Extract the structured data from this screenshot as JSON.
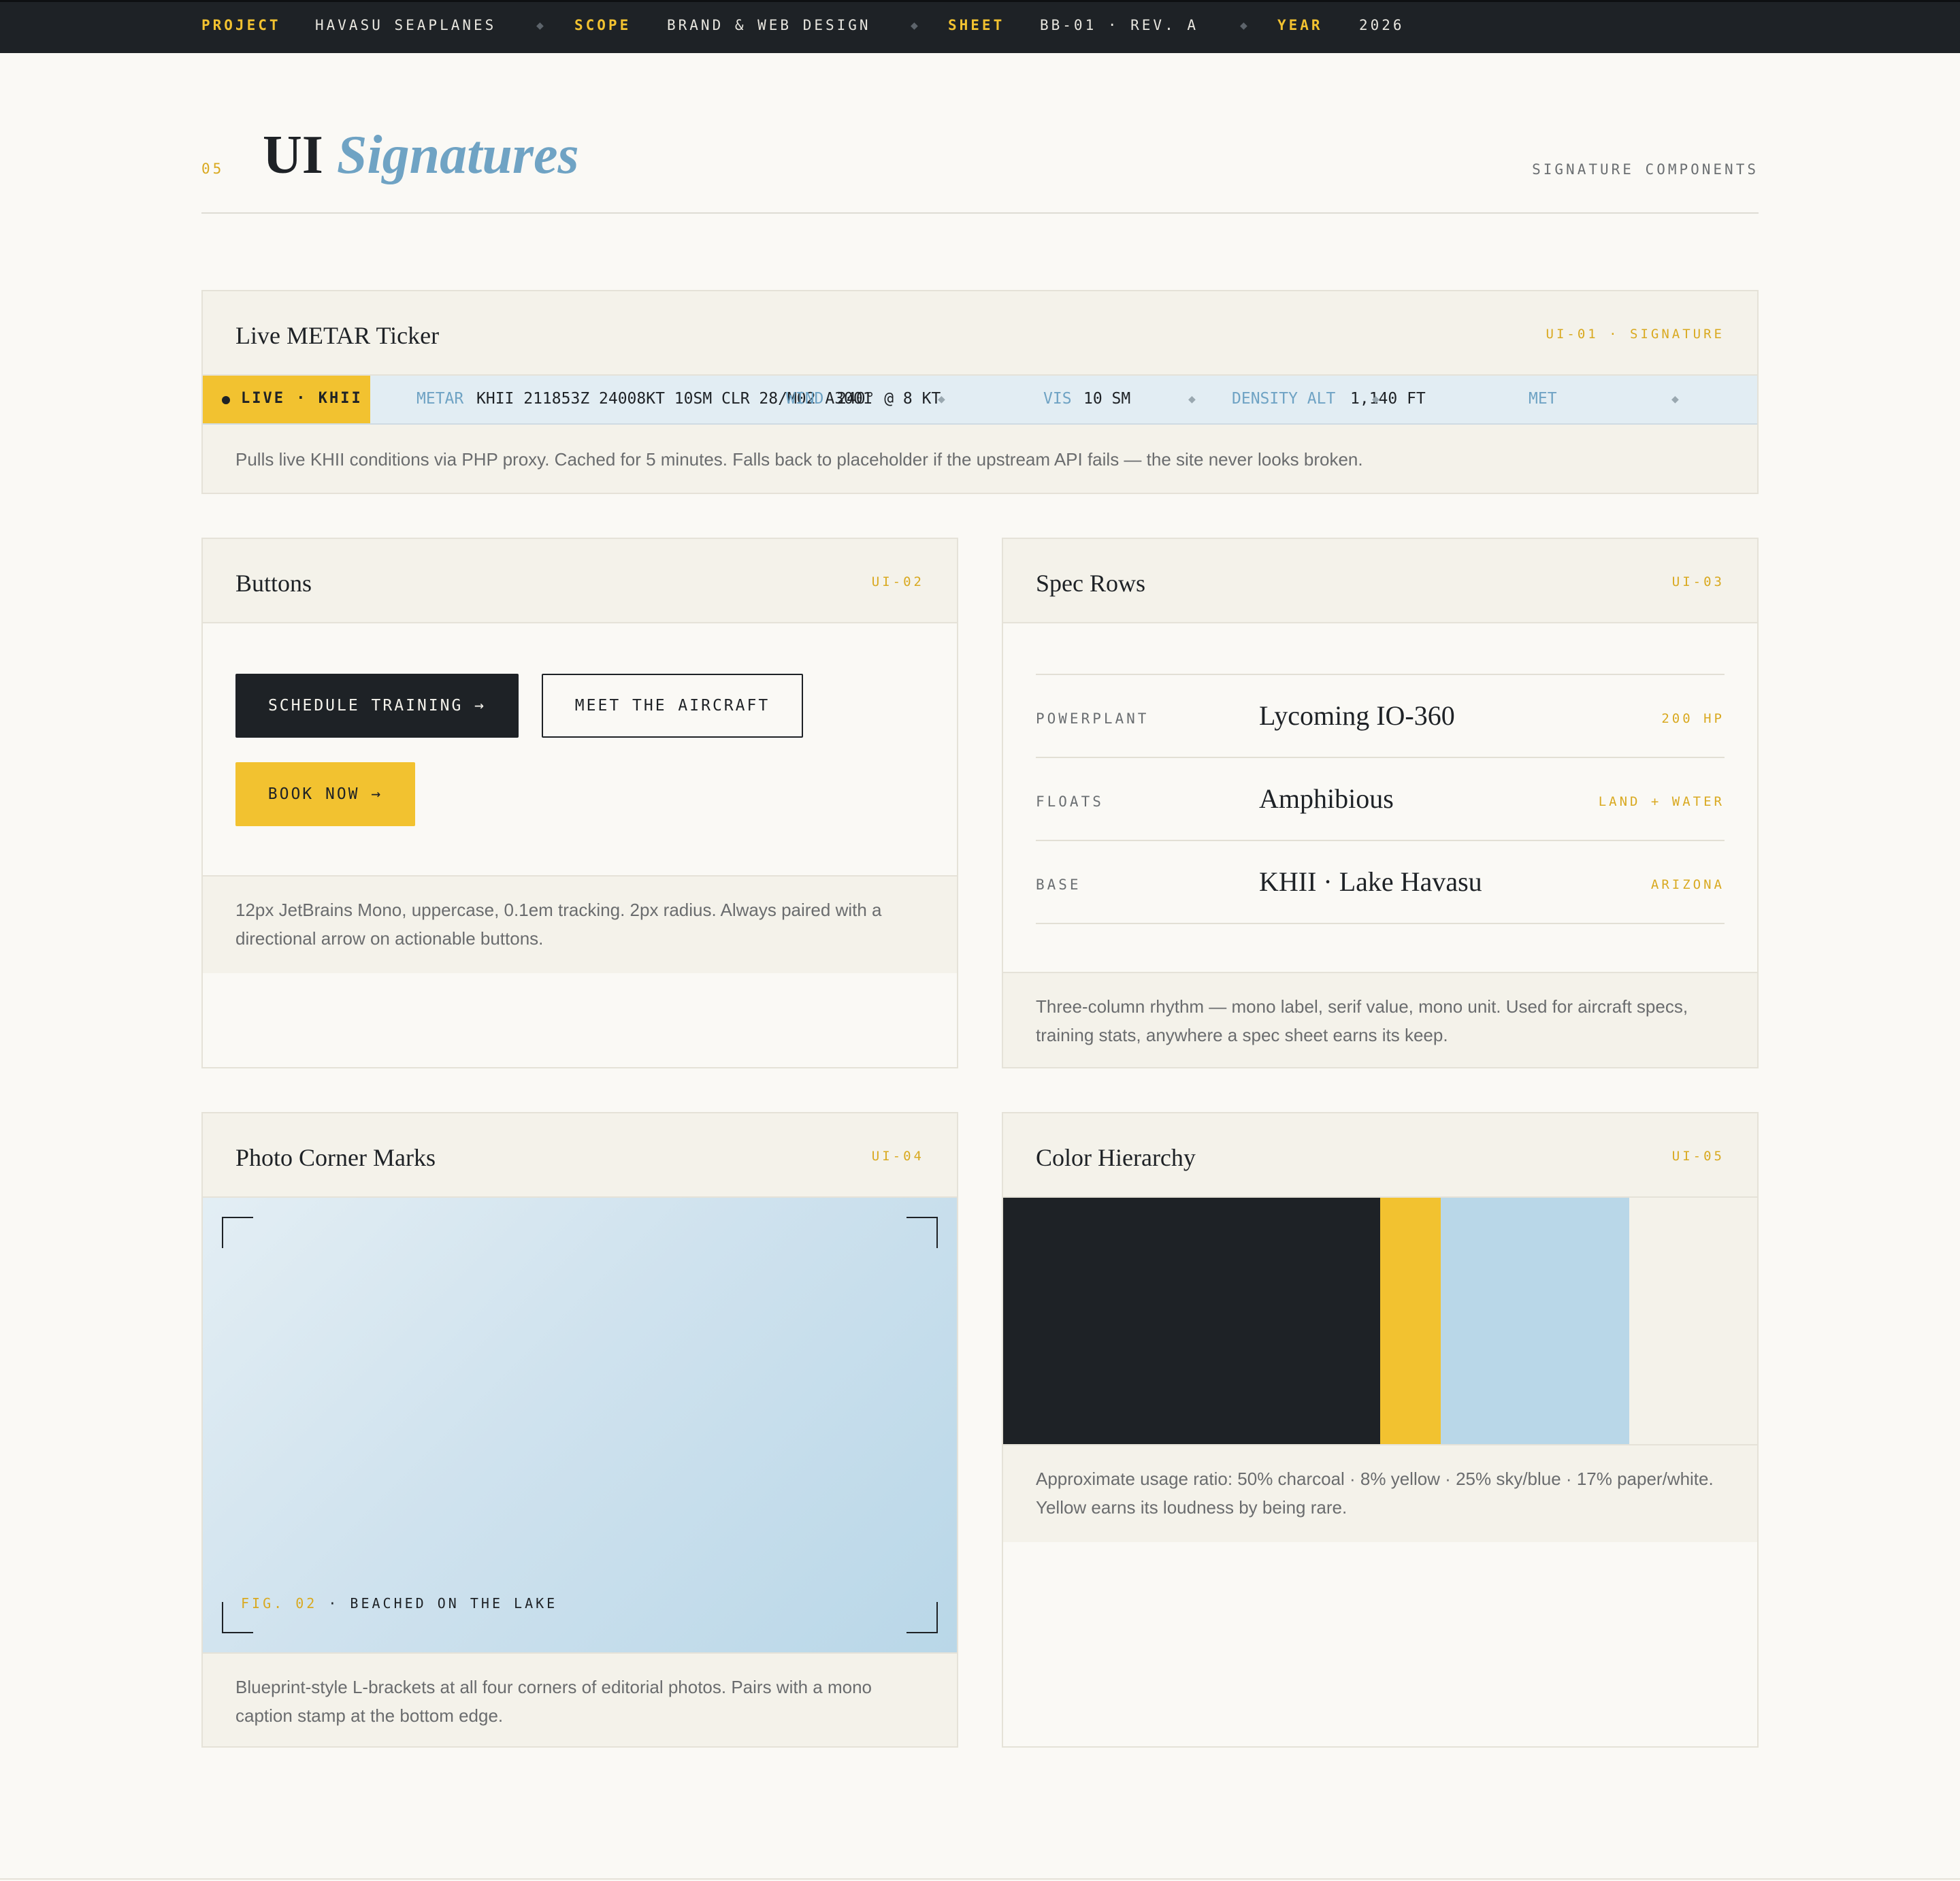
{
  "topbar": {
    "project_key": "PROJECT",
    "project_val": "HAVASU SEAPLANES",
    "scope_key": "SCOPE",
    "scope_val": "BRAND & WEB DESIGN",
    "sheet_key": "SHEET",
    "sheet_val": "BB-01 · REV. A",
    "year_key": "YEAR",
    "year_val": "2026",
    "separator": "◆"
  },
  "header": {
    "section_number": "05",
    "title_plain": "UI",
    "title_italic": "Signatures",
    "right_label": "SIGNATURE COMPONENTS"
  },
  "ticker_card": {
    "title": "Live METAR Ticker",
    "tag": "UI-01 · SIGNATURE",
    "live_label": "LIVE · KHII",
    "items": [
      {
        "label": "METAR",
        "value": "KHII 211853Z 24008KT 10SM CLR 28/M02 A3001"
      },
      {
        "label": "WIND",
        "value": "240° @ 8 KT"
      },
      {
        "label": "VIS",
        "value": "10 SM"
      },
      {
        "label": "DENSITY ALT",
        "value": "1,140 FT"
      },
      {
        "label": "MET",
        "value": ""
      }
    ],
    "note": "Pulls live KHII conditions via PHP proxy. Cached for 5 minutes. Falls back to placeholder if the upstream API fails — the site never looks broken."
  },
  "buttons_card": {
    "title": "Buttons",
    "tag": "UI-02",
    "primary": "SCHEDULE TRAINING →",
    "secondary": "MEET THE AIRCRAFT",
    "accent": "BOOK NOW →",
    "note": "12px JetBrains Mono, uppercase, 0.1em tracking. 2px radius. Always paired with a directional arrow on actionable buttons."
  },
  "spec_card": {
    "title": "Spec Rows",
    "tag": "UI-03",
    "rows": [
      {
        "label": "POWERPLANT",
        "value": "Lycoming IO-360",
        "unit": "200 HP"
      },
      {
        "label": "FLOATS",
        "value": "Amphibious",
        "unit": "LAND + WATER"
      },
      {
        "label": "BASE",
        "value": "KHII · Lake Havasu",
        "unit": "ARIZONA"
      }
    ],
    "note": "Three-column rhythm — mono label, serif value, mono unit. Used for aircraft specs, training stats, anywhere a spec sheet earns its keep."
  },
  "photo_card": {
    "title": "Photo Corner Marks",
    "tag": "UI-04",
    "caption_fig": "FIG. 02",
    "caption_text": " · BEACHED ON THE LAKE",
    "note": "Blueprint-style L-brackets at all four corners of editorial photos. Pairs with a mono caption stamp at the bottom edge."
  },
  "color_card": {
    "title": "Color Hierarchy",
    "tag": "UI-05",
    "segments": [
      {
        "name": "charcoal",
        "ratio": 50,
        "color": "#1e2226"
      },
      {
        "name": "yellow",
        "ratio": 8,
        "color": "#f2c230"
      },
      {
        "name": "sky/blue",
        "ratio": 25,
        "color": "#b9d7e8"
      },
      {
        "name": "paper/white",
        "ratio": 17,
        "color": "#f4f2ea"
      }
    ],
    "note": "Approximate usage ratio: 50% charcoal · 8% yellow · 25% sky/blue · 17% paper/white. Yellow earns its loudness by being rare."
  },
  "colors": {
    "charcoal": "#1e2226",
    "yellow": "#f2c230",
    "sky": "#6fa3c4",
    "paper": "#faf9f5"
  }
}
